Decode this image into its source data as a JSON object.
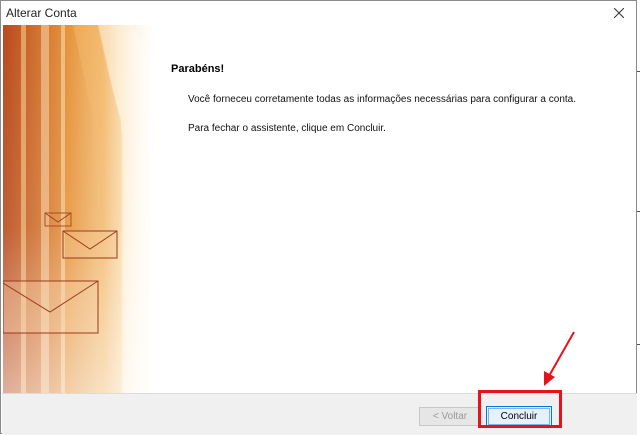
{
  "window": {
    "title": "Alterar Conta"
  },
  "content": {
    "heading": "Parabéns!",
    "line1": "Você forneceu corretamente todas as informações necessárias para configurar a conta.",
    "line2": "Para fechar o assistente, clique em Concluir."
  },
  "buttons": {
    "back": "< Voltar",
    "finish": "Concluir"
  },
  "colors": {
    "annotation": "#e8131a",
    "accent": "#0078d7"
  },
  "icons": [
    "close-icon",
    "envelope-icon",
    "arrow-annotation-icon"
  ]
}
